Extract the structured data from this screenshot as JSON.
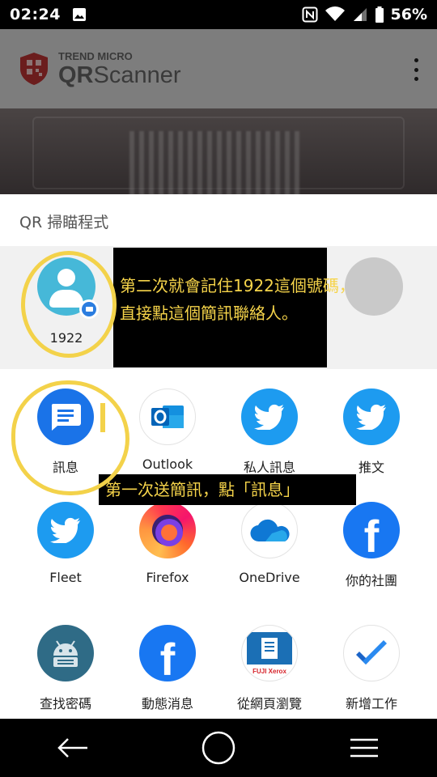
{
  "status_bar": {
    "time": "02:24",
    "battery_percent": "56%",
    "icons": [
      "image-icon",
      "nfc-icon",
      "wifi-icon",
      "signal-icon",
      "battery-icon"
    ]
  },
  "app": {
    "brand_small": "TREND MICRO",
    "brand_qr": "QR",
    "brand_scanner": "Scanner",
    "menu_icon": "overflow-menu-icon"
  },
  "share_sheet": {
    "title": "QR 掃瞄程式",
    "direct_share": [
      {
        "name": "1922",
        "icon": "contact-avatar-icon",
        "badge": "messages-badge-icon"
      }
    ],
    "apps": [
      {
        "label": "訊息",
        "icon": "messages-icon"
      },
      {
        "label": "Outlook",
        "icon": "outlook-icon"
      },
      {
        "label": "私人訊息",
        "icon": "twitter-icon"
      },
      {
        "label": "推文",
        "icon": "twitter-icon"
      },
      {
        "label": "Fleet",
        "icon": "twitter-icon"
      },
      {
        "label": "Firefox",
        "icon": "firefox-icon"
      },
      {
        "label": "OneDrive",
        "icon": "onedrive-icon"
      },
      {
        "label": "你的社團",
        "icon": "facebook-icon"
      },
      {
        "label": "查找密碼",
        "icon": "keepass-icon"
      },
      {
        "label": "動態消息",
        "icon": "facebook-icon"
      },
      {
        "label": "從網頁瀏覽",
        "icon": "fujixerox-icon"
      },
      {
        "label": "新增工作",
        "icon": "tasks-icon"
      }
    ],
    "fujixerox_text": "FUJI Xerox"
  },
  "annotations": {
    "note1_line1": "第二次就會記住1922這個號碼，",
    "note1_line2": "直接點這個簡訊聯絡人。",
    "note2": "第一次送簡訊，點「訊息」"
  },
  "colors": {
    "annotation_text": "#f6d44a",
    "annotation_circle": "#f3d24a",
    "twitter": "#1d9bf0",
    "facebook": "#1877f2",
    "messages": "#1a73e8"
  }
}
